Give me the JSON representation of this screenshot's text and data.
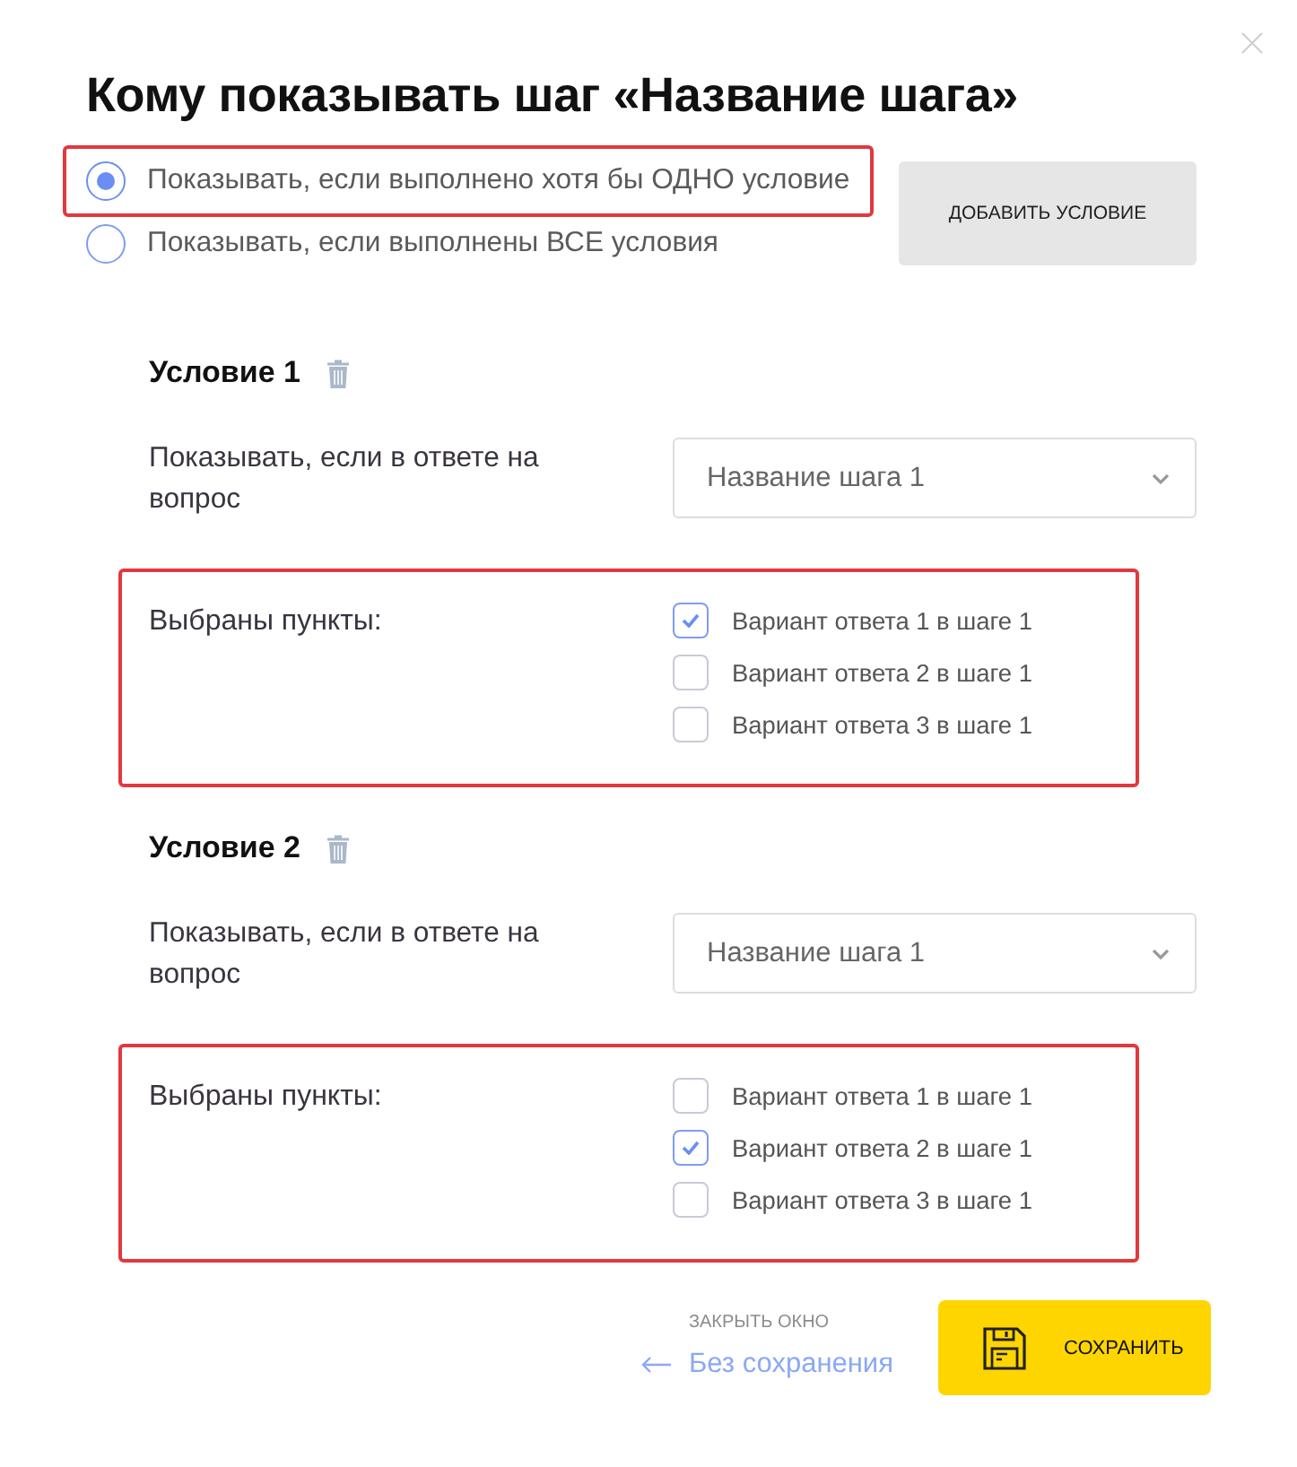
{
  "title": "Кому показывать шаг «Название шага»",
  "visibility_options": [
    {
      "label": "Показывать, если выполнено хотя бы ОДНО условие",
      "selected": true,
      "highlighted": true
    },
    {
      "label": "Показывать, если выполнены ВСЕ условия",
      "selected": false,
      "highlighted": false
    }
  ],
  "add_button": "ДОБАВИТЬ УСЛОВИЕ",
  "conditions": [
    {
      "title": "Условие 1",
      "question_label": "Показывать, если в ответе на вопрос",
      "question_select": {
        "value": "Название шага 1"
      },
      "answers_label": "Выбраны пункты:",
      "answers_highlighted": true,
      "answers": [
        {
          "label": "Вариант ответа 1 в шаге 1",
          "checked": true
        },
        {
          "label": "Вариант ответа 2 в шаге 1",
          "checked": false
        },
        {
          "label": "Вариант ответа 3 в шаге 1",
          "checked": false
        }
      ]
    },
    {
      "title": "Условие 2",
      "question_label": "Показывать, если в ответе на вопрос",
      "question_select": {
        "value": "Название шага 1"
      },
      "answers_label": "Выбраны пункты:",
      "answers_highlighted": true,
      "answers": [
        {
          "label": "Вариант ответа 1 в шаге 1",
          "checked": false
        },
        {
          "label": "Вариант ответа 2 в шаге 1",
          "checked": true
        },
        {
          "label": "Вариант ответа 3 в шаге 1",
          "checked": false
        }
      ]
    }
  ],
  "footer": {
    "close_caption": "ЗАКРЫТЬ ОКНО",
    "back_link": "Без сохранения",
    "save_button": "СОХРАНИТЬ"
  }
}
